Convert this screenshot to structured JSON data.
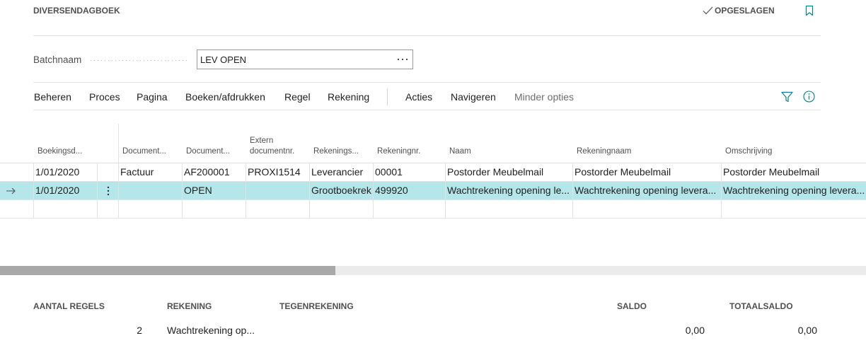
{
  "page": {
    "title": "DIVERSENDAGBOEK",
    "status": "OPGESLAGEN"
  },
  "batch": {
    "label": "Batchnaam",
    "value": "LEV OPEN"
  },
  "action_bar": {
    "menus": [
      "Beheren",
      "Proces",
      "Pagina",
      "Boeken/afdrukken",
      "Regel",
      "Rekening",
      "Acties",
      "Navigeren"
    ],
    "less_options": "Minder opties"
  },
  "table": {
    "headers": {
      "date": "Boekingsd...",
      "doc_type": "Document...",
      "doc_no": "Document...",
      "ext_doc_no": "Extern documentnr.",
      "account_type": "Rekenings...",
      "account_no": "Rekeningnr.",
      "name": "Naam",
      "account_name": "Rekeningnaam",
      "description": "Omschrijving"
    },
    "rows": [
      {
        "selected": false,
        "date": "1/01/2020",
        "doc_type": "Factuur",
        "doc_no": "AF200001",
        "ext_doc_no": "PROXI1514",
        "account_type": "Leverancier",
        "account_no": "00001",
        "name": "Postorder Meubelmail",
        "account_name": "Postorder Meubelmail",
        "description": "Postorder Meubelmail"
      },
      {
        "selected": true,
        "date": "1/01/2020",
        "doc_type": "",
        "doc_no": "OPEN",
        "ext_doc_no": "",
        "account_type": "Grootboekrek",
        "account_no": "499920",
        "name": "Wachtrekening opening le...",
        "account_name": "Wachtrekening opening levera...",
        "description": "Wachtrekening opening levera..."
      },
      {
        "selected": false,
        "date": "",
        "doc_type": "",
        "doc_no": "",
        "ext_doc_no": "",
        "account_type": "",
        "account_no": "",
        "name": "",
        "account_name": "",
        "description": ""
      }
    ],
    "horizontal_scroll": {
      "offset_fraction": 0,
      "visible_fraction": 0.387
    }
  },
  "footer": {
    "line_count": {
      "label": "AANTAL REGELS",
      "value": "2"
    },
    "account": {
      "label": "REKENING",
      "value": "Wachtrekening op..."
    },
    "bal_account": {
      "label": "TEGENREKENING"
    },
    "balance": {
      "label": "SALDO",
      "value": "0,00"
    },
    "total_balance": {
      "label": "TOTAALSALDO",
      "value": "0,00"
    }
  },
  "icons": {
    "saved": "checkmark-icon",
    "bookmark": "bookmark-icon",
    "lookup": "ellipsis-icon",
    "filter": "filter-icon",
    "info": "info-icon",
    "current_row": "arrow-right-icon",
    "row_actions": "vertical-ellipsis-icon"
  },
  "colors": {
    "accent": "#00838f",
    "selected_row": "#b4e6ea",
    "text": "#212121",
    "label": "#505050",
    "scroll_thumb": "#a8a8a8",
    "scroll_track": "#ebebeb"
  }
}
